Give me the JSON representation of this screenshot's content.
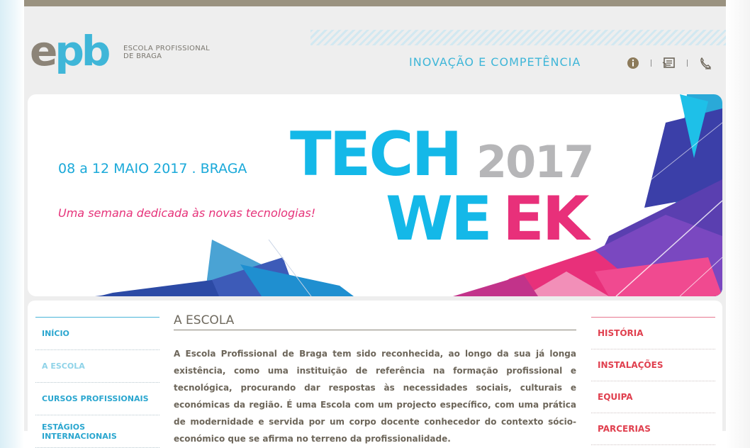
{
  "header": {
    "logo_mark": "epb",
    "school_name_line1": "ESCOLA PROFISSIONAL",
    "school_name_line2": "DE BRAGA",
    "tagline": "INOVAÇÃO E COMPETÊNCIA",
    "icons": [
      "info-icon",
      "contact-card-icon",
      "phone-icon"
    ]
  },
  "banner": {
    "title_part1": "TECH",
    "year": "2017",
    "title_part2": "WE3K",
    "date": "08 a 12 MAIO 2017 . BRAGA",
    "subtitle": "Uma semana dedicada às novas tecnologias!"
  },
  "left_nav": {
    "items": [
      {
        "label": "INÍCIO"
      },
      {
        "label": "A ESCOLA"
      },
      {
        "label": "CURSOS PROFISSIONAIS"
      },
      {
        "label": "ESTÁGIOS INTERNACIONAIS"
      }
    ]
  },
  "main": {
    "title": "A ESCOLA",
    "body": "A Escola Profissional de Braga tem sido reconhecida, ao longo da sua já longa existência, como uma instituição de referência na formação profissional e tecnológica, procurando dar respostas às necessidades sociais, culturais e económicas da região. É uma Escola com um projecto específico, com uma prática de modernidade e servida por um corpo docente conhecedor do contexto sócio-económico que se afirma no terreno da profissionalidade."
  },
  "right_nav": {
    "items": [
      {
        "label": "HISTÓRIA"
      },
      {
        "label": "INSTALAÇÕES"
      },
      {
        "label": "EQUIPA"
      },
      {
        "label": "PARCERIAS"
      }
    ]
  },
  "colors": {
    "brand_blue": "#3fb6d8",
    "brand_grey": "#8c8478",
    "accent_pink": "#e6337a",
    "nav_red": "#e0404f"
  }
}
